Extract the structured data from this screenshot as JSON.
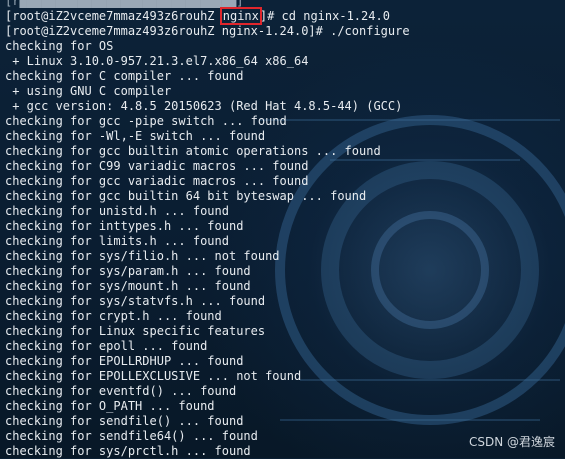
{
  "terminal": {
    "top_line": {
      "prefix": "[root@iZ2vceme7mmaz493z6rouhZ ",
      "highlight": "nginx",
      "suffix": "]# cd nginx-1.24.0"
    },
    "lines": [
      "[root@iZ2vceme7mmaz493z6rouhZ nginx-1.24.0]# ./configure",
      "checking for OS",
      " + Linux 3.10.0-957.21.3.el7.x86_64 x86_64",
      "checking for C compiler ... found",
      " + using GNU C compiler",
      " + gcc version: 4.8.5 20150623 (Red Hat 4.8.5-44) (GCC)",
      "checking for gcc -pipe switch ... found",
      "checking for -Wl,-E switch ... found",
      "checking for gcc builtin atomic operations ... found",
      "checking for C99 variadic macros ... found",
      "checking for gcc variadic macros ... found",
      "checking for gcc builtin 64 bit byteswap ... found",
      "checking for unistd.h ... found",
      "checking for inttypes.h ... found",
      "checking for limits.h ... found",
      "checking for sys/filio.h ... not found",
      "checking for sys/param.h ... found",
      "checking for sys/mount.h ... found",
      "checking for sys/statvfs.h ... found",
      "checking for crypt.h ... found",
      "checking for Linux specific features",
      "checking for epoll ... found",
      "checking for EPOLLRDHUP ... found",
      "checking for EPOLLEXCLUSIVE ... not found",
      "checking for eventfd() ... found",
      "checking for O_PATH ... found",
      "checking for sendfile() ... found",
      "checking for sendfile64() ... found",
      "checking for sys/prctl.h ... found"
    ]
  },
  "watermark": "CSDN @君逸宸",
  "colors": {
    "text": "#e8ecf0",
    "highlight_box": "#e0262c",
    "background": "#0b1f33"
  }
}
